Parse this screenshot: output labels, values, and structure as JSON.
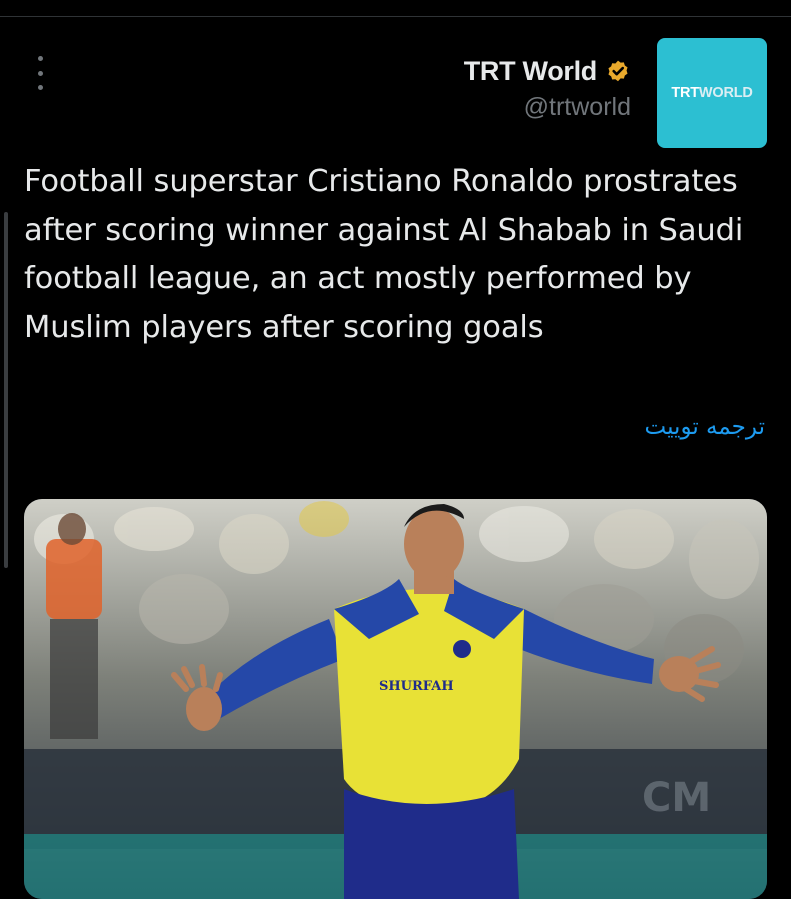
{
  "author": {
    "name": "TRT World",
    "handle": "@trtworld",
    "verified_icon": "verified-badge-icon",
    "verified_color": "#e9a92c"
  },
  "avatar": {
    "text_part1": "TRT",
    "text_part2": "WORLD",
    "bg_color": "#2cbfd2"
  },
  "tweet": {
    "text": "Football superstar Cristiano Ronaldo prostrates after scoring winner against Al Shabab in Saudi football league, an act mostly performed by Muslim players after scoring goals",
    "translate_label": "ترجمه توییت"
  },
  "media": {
    "jersey_sponsor": "SHURFAH"
  },
  "colors": {
    "background": "#000000",
    "text": "#e7e9ea",
    "secondary_text": "#71767b",
    "link": "#1d9bf0"
  }
}
